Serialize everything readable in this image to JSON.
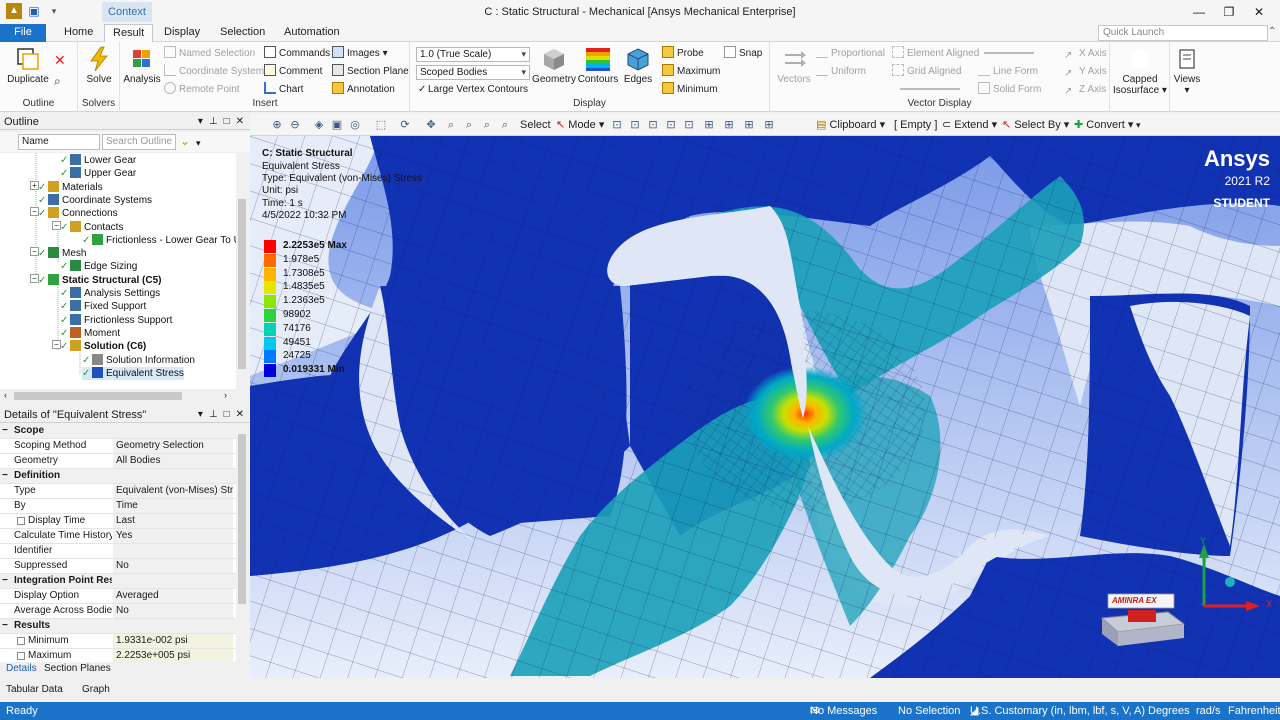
{
  "window": {
    "title": "C : Static Structural - Mechanical [Ansys Mechanical Enterprise]",
    "context_tab": "Context",
    "controls": [
      "—",
      "❐",
      "✕"
    ]
  },
  "tabs": {
    "file": "File",
    "items": [
      "Home",
      "Result",
      "Display",
      "Selection",
      "Automation"
    ],
    "active": "Result",
    "quick_launch_placeholder": "Quick Launch"
  },
  "ribbon": {
    "outline": {
      "duplicate": "Duplicate",
      "label": "Outline"
    },
    "solvers": {
      "solve": "Solve",
      "label": "Solvers"
    },
    "analysis": "Analysis",
    "insert": {
      "named_selection": "Named Selection",
      "coordinate_system": "Coordinate System",
      "remote_point": "Remote Point",
      "commands": "Commands",
      "comment": "Comment",
      "chart": "Chart",
      "images": "Images",
      "section_plane": "Section Plane",
      "annotation": "Annotation",
      "label": "Insert"
    },
    "display": {
      "scale": "1.0 (True Scale)",
      "scope": "Scoped Bodies",
      "large_vertex": "Large Vertex Contours",
      "geometry": "Geometry",
      "contours": "Contours",
      "edges": "Edges",
      "probe": "Probe",
      "maximum": "Maximum",
      "minimum": "Minimum",
      "snap": "Snap",
      "label": "Display"
    },
    "vector": {
      "vectors": "Vectors",
      "proportional": "Proportional",
      "uniform": "Uniform",
      "element_aligned": "Element Aligned",
      "grid_aligned": "Grid Aligned",
      "line_form": "Line Form",
      "solid_form": "Solid Form",
      "x_axis": "X Axis",
      "y_axis": "Y Axis",
      "z_axis": "Z Axis",
      "label": "Vector Display"
    },
    "capped": "Capped Isosurface",
    "views": "Views"
  },
  "outline": {
    "title": "Outline",
    "filter_select": "Name",
    "search_placeholder": "Search Outline",
    "tree": [
      {
        "label": "Lower Gear",
        "indent": 78,
        "icon": "body"
      },
      {
        "label": "Upper Gear",
        "indent": 78,
        "icon": "body"
      },
      {
        "label": "Materials",
        "indent": 56,
        "icon": "folder"
      },
      {
        "label": "Coordinate Systems",
        "indent": 56,
        "icon": "coord"
      },
      {
        "label": "Connections",
        "indent": 56,
        "icon": "folder"
      },
      {
        "label": "Contacts",
        "indent": 78,
        "icon": "folder"
      },
      {
        "label": "Frictionless - Lower Gear To U",
        "indent": 100,
        "icon": "contact"
      },
      {
        "label": "Mesh",
        "indent": 56,
        "icon": "mesh"
      },
      {
        "label": "Edge Sizing",
        "indent": 78,
        "icon": "sizing"
      },
      {
        "label": "Static Structural (C5)",
        "indent": 56,
        "icon": "static",
        "bold": true
      },
      {
        "label": "Analysis Settings",
        "indent": 78,
        "icon": "settings"
      },
      {
        "label": "Fixed Support",
        "indent": 78,
        "icon": "support"
      },
      {
        "label": "Frictionless Support",
        "indent": 78,
        "icon": "support"
      },
      {
        "label": "Moment",
        "indent": 78,
        "icon": "moment"
      },
      {
        "label": "Solution (C6)",
        "indent": 78,
        "icon": "solution",
        "bold": true
      },
      {
        "label": "Solution Information",
        "indent": 100,
        "icon": "info"
      },
      {
        "label": "Equivalent Stress",
        "indent": 100,
        "icon": "stress",
        "selected": true
      }
    ]
  },
  "details": {
    "title": "Details of \"Equivalent Stress\"",
    "rows": [
      {
        "type": "sec",
        "k": "Scope"
      },
      {
        "k": "Scoping Method",
        "v": "Geometry Selection"
      },
      {
        "k": "Geometry",
        "v": "All Bodies"
      },
      {
        "type": "sec",
        "k": "Definition"
      },
      {
        "k": "Type",
        "v": "Equivalent (von-Mises) Str..."
      },
      {
        "k": "By",
        "v": "Time"
      },
      {
        "k": "Display Time",
        "v": "Last",
        "cb": true
      },
      {
        "k": "Calculate Time History",
        "v": "Yes"
      },
      {
        "k": "Identifier",
        "v": ""
      },
      {
        "k": "Suppressed",
        "v": "No"
      },
      {
        "type": "sec",
        "k": "Integration Point Results"
      },
      {
        "k": "Display Option",
        "v": "Averaged"
      },
      {
        "k": "Average Across Bodies",
        "v": "No"
      },
      {
        "type": "sec",
        "k": "Results"
      },
      {
        "k": "Minimum",
        "v": "1.9331e-002 psi",
        "cb": true,
        "hl": true
      },
      {
        "k": "Maximum",
        "v": "2.2253e+005 psi",
        "cb": true,
        "hl": true
      }
    ],
    "tabs": [
      "Details",
      "Section Planes"
    ]
  },
  "viewport_toolbar": {
    "select": "Select",
    "mode": "Mode",
    "clipboard": "Clipboard",
    "empty": "[ Empty ]",
    "extend": "Extend",
    "select_by": "Select By",
    "convert": "Convert"
  },
  "result": {
    "title": "C: Static Structural",
    "name": "Equivalent Stress",
    "type": "Type: Equivalent (von-Mises) Stress",
    "unit": "Unit: psi",
    "time": "Time: 1 s",
    "date": "4/5/2022 10:32 PM",
    "legend": [
      {
        "label": "2.2253e5 Max",
        "color": "#ff0000",
        "bold": true
      },
      {
        "label": "1.978e5",
        "color": "#ff6a00"
      },
      {
        "label": "1.7308e5",
        "color": "#ffb400"
      },
      {
        "label": "1.4835e5",
        "color": "#e6e600"
      },
      {
        "label": "1.2363e5",
        "color": "#8ce600"
      },
      {
        "label": "98902",
        "color": "#2ad43a"
      },
      {
        "label": "74176",
        "color": "#00d4b4"
      },
      {
        "label": "49451",
        "color": "#00c8f0"
      },
      {
        "label": "24725",
        "color": "#0078ff"
      },
      {
        "label": "0.019331 Min",
        "color": "#0000dc",
        "bold": true
      }
    ]
  },
  "brand": {
    "name": "Ansys",
    "version": "2021 R2",
    "edition": "STUDENT"
  },
  "watermark": "AMINRA EX",
  "triad": {
    "x": "X",
    "y": "Y"
  },
  "bottom_tabs": [
    "Tabular Data",
    "Graph"
  ],
  "status": {
    "ready": "Ready",
    "messages": "No Messages",
    "selection": "No Selection",
    "units": "U.S. Customary (in, lbm, lbf, s, V, A)",
    "angle": "Degrees",
    "rate": "rad/s",
    "temp": "Fahrenheit"
  },
  "colors": {
    "accent": "#1a73c8",
    "mesh_bg": "#1232b4",
    "sky_top": "#7a9ae8",
    "sky_bottom": "#e8eefa"
  }
}
